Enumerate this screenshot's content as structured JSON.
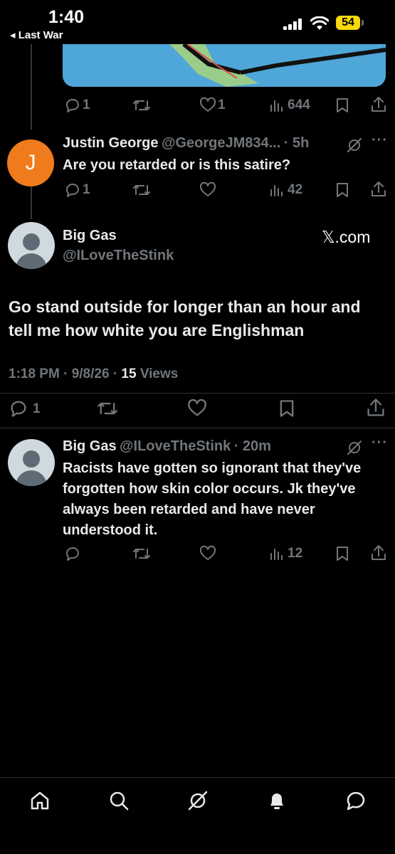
{
  "status_bar": {
    "time": "1:40",
    "back_label": "◂ Last War",
    "battery_level": "54"
  },
  "tweet1": {
    "reply_count": "1",
    "like_count": "1",
    "views": "644"
  },
  "tweet2": {
    "avatar_letter": "J",
    "avatar_color": "#f07b1c",
    "name": "Justin George",
    "handle": "@GeorgeJM834...",
    "time": "· 5h",
    "text": "Are you retarded or is this satire?",
    "reply_count": "1",
    "views": "42"
  },
  "main_tweet": {
    "name": "Big Gas",
    "handle": "@ILoveTheStink",
    "watermark": "𝕏.com",
    "text": "Go stand outside for longer than an hour and tell me how white you are Englishman",
    "timestamp": "1:18 PM · 9/8/26 · ",
    "views_count": "15",
    "views_label": " Views",
    "reply_count": "1"
  },
  "reply": {
    "name": "Big Gas",
    "handle": "@ILoveTheStink",
    "time": "· 20m",
    "text": "Racists have gotten so ignorant that they've forgotten how skin color occurs. Jk they've always been retarded and have never understood it.",
    "views": "12"
  },
  "icons": [
    "reply-icon",
    "retweet-icon",
    "like-icon",
    "views-icon",
    "bookmark-icon",
    "share-icon",
    "grok-icon",
    "more-icon",
    "home-icon",
    "search-icon",
    "notifications-icon",
    "messages-icon"
  ],
  "colors": {
    "background": "#000000",
    "text": "#e7e9ea",
    "muted": "#71767b",
    "battery": "#f5d90a"
  }
}
